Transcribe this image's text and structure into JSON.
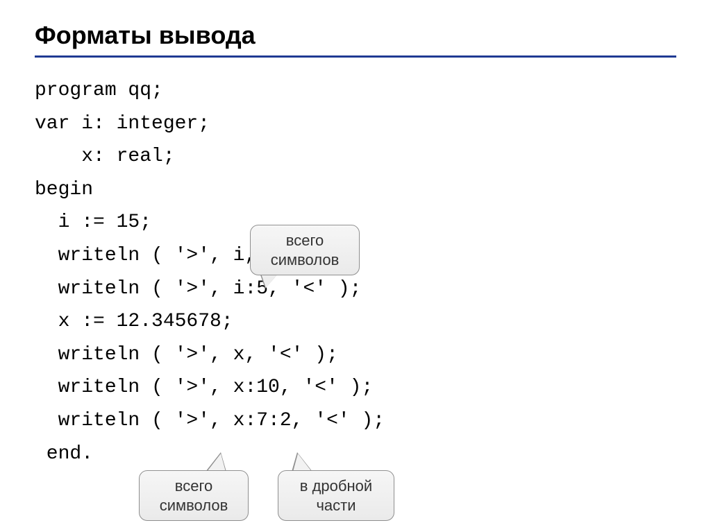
{
  "title": "Форматы вывода",
  "code": {
    "l1": "program qq;",
    "l2": "var i: integer;",
    "l3": "    x: real;",
    "l4": "begin",
    "l5": "  i := 15;",
    "l6": "  writeln ( '>', i, '",
    "l7": "  writeln ( '>', i:5, '<' );",
    "l8": "  x := 12.345678;",
    "l9": "  writeln ( '>', x, '<' );",
    "l10": "  writeln ( '>', x:10, '<' );",
    "l11": "  writeln ( '>', x:7:2, '<' );",
    "l12": " end."
  },
  "callouts": {
    "total_chars_1": "всего\nсимволов",
    "total_chars_2": "всего\nсимволов",
    "fractional": "в дробной\nчасти"
  }
}
